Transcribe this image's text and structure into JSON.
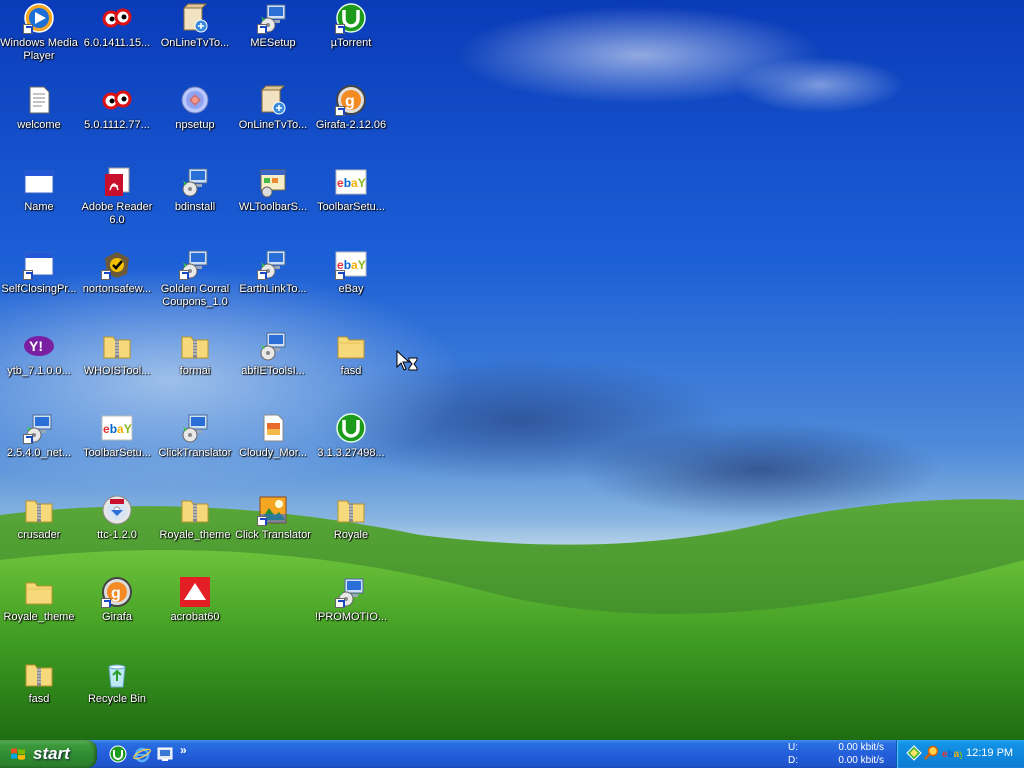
{
  "desktop": {
    "icons": [
      {
        "label": "Windows Media Player",
        "icon": "windows-media-player-icon"
      },
      {
        "label": "6.0.1411.15...",
        "icon": "eyes-app-icon"
      },
      {
        "label": "OnLineTvTo...",
        "icon": "installer-box-icon"
      },
      {
        "label": "MESetup",
        "icon": "setup-computer-icon"
      },
      {
        "label": "µTorrent",
        "icon": "utorrent-icon"
      },
      {
        "label": "welcome",
        "icon": "text-document-icon"
      },
      {
        "label": "5.0.1112.77...",
        "icon": "eyes-app-icon"
      },
      {
        "label": "npsetup",
        "icon": "setup-disc-icon"
      },
      {
        "label": "OnLineTvTo...",
        "icon": "installer-box-icon"
      },
      {
        "label": "Girafa-2.12.06",
        "icon": "girafa-icon"
      },
      {
        "label": "Name",
        "icon": "application-window-icon"
      },
      {
        "label": "Adobe Reader 6.0",
        "icon": "adobe-reader-icon"
      },
      {
        "label": "bdinstall",
        "icon": "setup-computer-icon"
      },
      {
        "label": "WLToolbarS...",
        "icon": "toolbar-setup-icon"
      },
      {
        "label": "ToolbarSetu...",
        "icon": "ebay-icon"
      },
      {
        "label": "SelfClosingPr...",
        "icon": "application-window-icon"
      },
      {
        "label": "nortonsafew...",
        "icon": "norton-icon"
      },
      {
        "label": "Golden Corral Coupons_1.0",
        "icon": "setup-computer-icon"
      },
      {
        "label": "EarthLinkTo...",
        "icon": "setup-computer-icon"
      },
      {
        "label": "eBay",
        "icon": "ebay-icon"
      },
      {
        "label": "ytb_7.1.0.0...",
        "icon": "yahoo-icon"
      },
      {
        "label": "WHOISTool...",
        "icon": "zip-folder-icon"
      },
      {
        "label": "formai",
        "icon": "zip-folder-icon"
      },
      {
        "label": "abfIEToolsI...",
        "icon": "setup-computer-icon"
      },
      {
        "label": "fasd",
        "icon": "folder-icon"
      },
      {
        "label": "2.5.4.0_net...",
        "icon": "setup-computer-icon"
      },
      {
        "label": "ToolbarSetu...",
        "icon": "ebay-icon"
      },
      {
        "label": "ClickTranslator",
        "icon": "setup-computer-icon"
      },
      {
        "label": "Cloudy_Mor...",
        "icon": "image-file-icon"
      },
      {
        "label": "3.1.3.27498...",
        "icon": "utorrent-icon"
      },
      {
        "label": "crusader",
        "icon": "zip-folder-icon"
      },
      {
        "label": "ttc-1.2.0",
        "icon": "cd-icon"
      },
      {
        "label": "Royale_theme",
        "icon": "zip-folder-icon"
      },
      {
        "label": "Click Translator",
        "icon": "click-translator-icon"
      },
      {
        "label": "Royale",
        "icon": "zip-folder-icon"
      },
      {
        "label": "Royale_theme",
        "icon": "folder-icon"
      },
      {
        "label": "Girafa",
        "icon": "girafa-icon"
      },
      {
        "label": "acrobat60",
        "icon": "acrobat-icon"
      },
      {
        "label": "!PROMOTIO...",
        "icon": "setup-computer-icon"
      },
      {
        "label": "fasd",
        "icon": "zip-folder-icon"
      },
      {
        "label": "Recycle Bin",
        "icon": "recycle-bin-icon"
      }
    ]
  },
  "taskbar": {
    "start_label": "start",
    "quick_launch": [
      "utorrent-icon",
      "internet-explorer-icon",
      "show-desktop-icon"
    ],
    "more_label": "»",
    "net_meter": {
      "upload_key": "U:",
      "upload_value": "0.00 kbit/s",
      "download_key": "D:",
      "download_value": "0.00 kbit/s"
    },
    "tray_icons": [
      "network-icon",
      "search-icon",
      "ebay-icon"
    ],
    "clock": "12:19 PM"
  }
}
